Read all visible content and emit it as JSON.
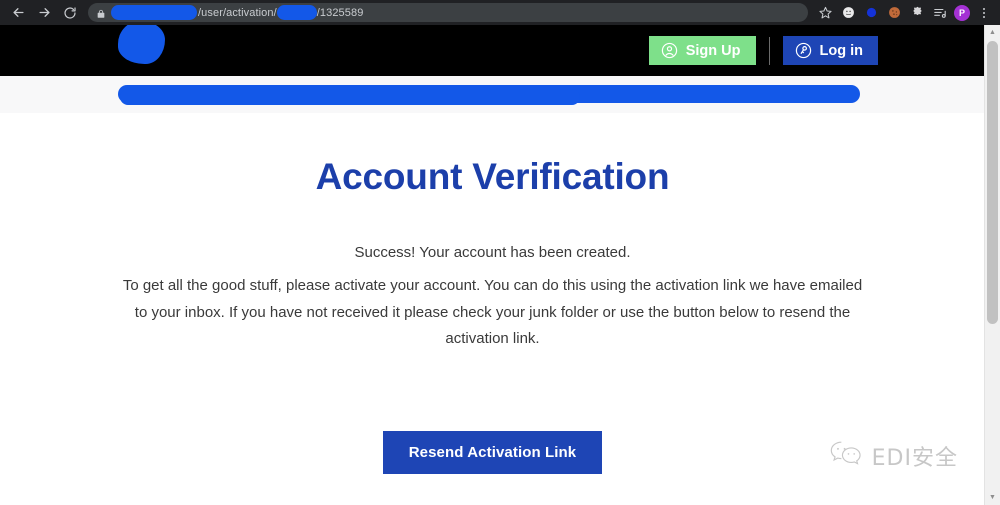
{
  "browser": {
    "nav": {
      "back_icon": "arrow-left-icon",
      "forward_icon": "arrow-right-icon",
      "reload_icon": "reload-icon"
    },
    "omnibox": {
      "lock_icon": "lock-icon",
      "url_path": "/user/activation/",
      "url_suffix": "/1325589",
      "redacted": true
    },
    "toolbar_icons": [
      {
        "name": "bookmark-star-icon",
        "glyph": "☆"
      },
      {
        "name": "extension-circle-icon",
        "glyph": "●"
      },
      {
        "name": "extension-blue-icon",
        "glyph": "●"
      },
      {
        "name": "cookie-icon",
        "glyph": "●"
      },
      {
        "name": "extensions-puzzle-icon",
        "glyph": "❖"
      },
      {
        "name": "media-list-icon",
        "glyph": "≡"
      }
    ],
    "profile": {
      "name": "profile-avatar",
      "initial": "P",
      "color": "#a431d4"
    },
    "menu_icon": "kebab-menu-icon"
  },
  "site_header": {
    "logo": {
      "name": "site-logo",
      "redacted": true,
      "color": "#1358e8"
    },
    "signup": {
      "label": "Sign Up",
      "icon": "user-circle-icon",
      "bg": "#7ee08a"
    },
    "login": {
      "label": "Log in",
      "icon": "key-circle-icon",
      "bg": "#1e45b5"
    }
  },
  "breadcrumb": {
    "redacted": true,
    "color": "#1358e8"
  },
  "main": {
    "title": "Account Verification",
    "title_color": "#1c3faa",
    "lead": "Success! Your account has been created.",
    "body": "To get all the good stuff, please activate your account. You can do this using the activation link we have emailed to your inbox. If you have not received it please check your junk folder or use the button below to resend the activation link.",
    "cta": {
      "label": "Resend Activation Link",
      "bg": "#1e45b5"
    }
  },
  "watermark": {
    "icon": "wechat-icon",
    "text": "EDI安全"
  },
  "scrollbar": {
    "up_glyph": "▲",
    "down_glyph": "▼"
  }
}
